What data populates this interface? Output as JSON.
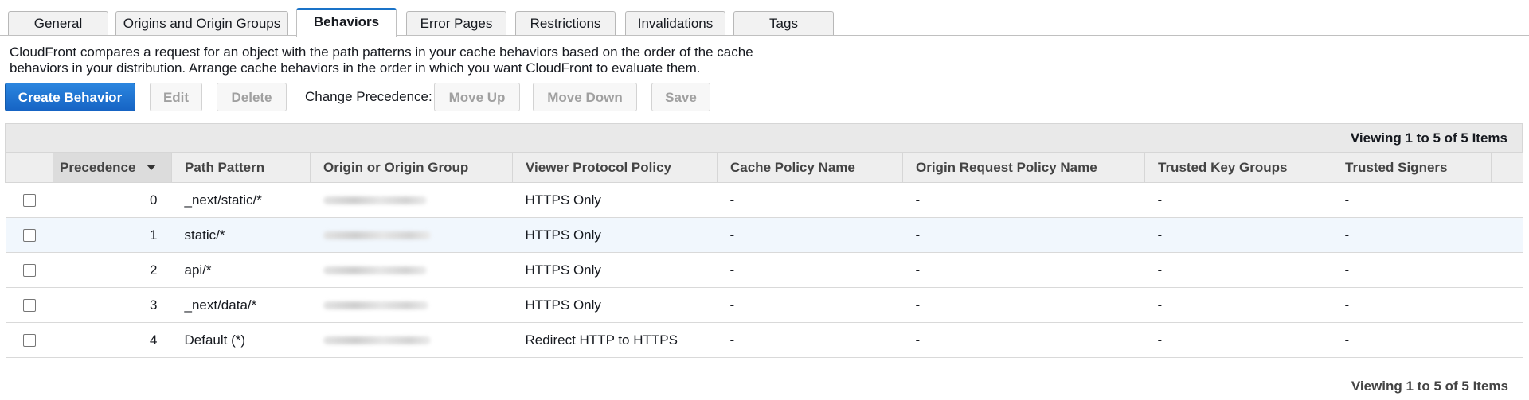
{
  "tabs": [
    {
      "label": "General"
    },
    {
      "label": "Origins and Origin Groups"
    },
    {
      "label": "Behaviors"
    },
    {
      "label": "Error Pages"
    },
    {
      "label": "Restrictions"
    },
    {
      "label": "Invalidations"
    },
    {
      "label": "Tags"
    }
  ],
  "active_tab": "Behaviors",
  "description": "CloudFront compares a request for an object with the path patterns in your cache behaviors based on the order of the cache behaviors in your distribution. Arrange cache behaviors in the order in which you want CloudFront to evaluate them.",
  "toolbar": {
    "create_label": "Create Behavior",
    "edit_label": "Edit",
    "delete_label": "Delete",
    "change_precedence_label": "Change Precedence:",
    "move_up_label": "Move Up",
    "move_down_label": "Move Down",
    "save_label": "Save"
  },
  "table": {
    "summary": "Viewing 1 to 5 of 5 Items",
    "columns": [
      "Precedence",
      "Path Pattern",
      "Origin or Origin Group",
      "Viewer Protocol Policy",
      "Cache Policy Name",
      "Origin Request Policy Name",
      "Trusted Key Groups",
      "Trusted Signers"
    ],
    "sorted_column": "Precedence",
    "rows": [
      {
        "precedence": "0",
        "path": "_next/static/*",
        "protocol": "HTTPS Only",
        "cache": "-",
        "origin_request": "-",
        "key_groups": "-",
        "signers": "-"
      },
      {
        "precedence": "1",
        "path": "static/*",
        "protocol": "HTTPS Only",
        "cache": "-",
        "origin_request": "-",
        "key_groups": "-",
        "signers": "-"
      },
      {
        "precedence": "2",
        "path": "api/*",
        "protocol": "HTTPS Only",
        "cache": "-",
        "origin_request": "-",
        "key_groups": "-",
        "signers": "-"
      },
      {
        "precedence": "3",
        "path": "_next/data/*",
        "protocol": "HTTPS Only",
        "cache": "-",
        "origin_request": "-",
        "key_groups": "-",
        "signers": "-"
      },
      {
        "precedence": "4",
        "path": "Default (*)",
        "protocol": "Redirect HTTP to HTTPS",
        "cache": "-",
        "origin_request": "-",
        "key_groups": "-",
        "signers": "-"
      }
    ]
  },
  "footer_summary": "Viewing 1 to 5 of 5 Items"
}
